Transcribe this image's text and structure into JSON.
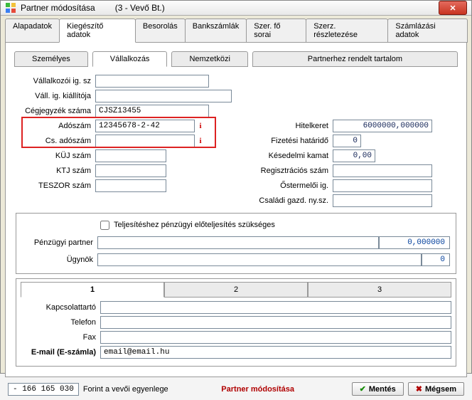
{
  "window": {
    "title": "Partner módosítása",
    "subtitle": "(3  -  Vevő Bt.)"
  },
  "tabs": {
    "alapadatok": "Alapadatok",
    "kiegeszito": "Kiegészítő adatok",
    "besorolas": "Besorolás",
    "bankszamlak": "Bankszámlák",
    "szerfosorai": "Szer. fő sorai",
    "szerreszlet": "Szerz. részletezése",
    "szamlazasi": "Számlázási adatok"
  },
  "subtabs": {
    "szemelyes": "Személyes",
    "vallalkozas": "Vállalkozás",
    "nemzetkozi": "Nemzetközi",
    "partnerhez": "Partnerhez rendelt tartalom"
  },
  "labels": {
    "vallalkozoi": "Vállalkozói ig. sz",
    "vallig": "Váll. ig. kiállítója",
    "cegjegyzek": "Cégjegyzék száma",
    "adoszam": "Adószám",
    "csadoszam": "Cs. adószám",
    "kuj": "KÜJ szám",
    "ktj": "KTJ szám",
    "teszor": "TESZOR szám",
    "hitelkeret": "Hitelkeret",
    "fizhatarido": "Fizetési határidő",
    "kesedelmi": "Késedelmi kamat",
    "regszam": "Regisztrációs szám",
    "ostermelo": "Őstermelői ig.",
    "csaladi": "Családi gazd. ny.sz.",
    "teljesiteshez": "Teljesítéshez pénzügyi előteljesítés szükséges",
    "penzugyipartner": "Pénzügyi partner",
    "ugynok": "Ügynök"
  },
  "values": {
    "vallalkozoi": "",
    "vallig": "",
    "cegjegyzek": "CJSZ13455",
    "adoszam": "12345678-2-42",
    "csadoszam": "",
    "kuj": "",
    "ktj": "",
    "teszor": "",
    "hitelkeret": "6000000,000000",
    "fizhatarido": "0",
    "kesedelmi": "0,00",
    "regszam": "",
    "ostermelo": "",
    "csaladi": "",
    "partner_rate": "0,000000",
    "ugynok_val": "0"
  },
  "contacts": {
    "tab1": "1",
    "tab2": "2",
    "tab3": "3",
    "kapcsolattarto_label": "Kapcsolattartó",
    "telefon_label": "Telefon",
    "fax_label": "Fax",
    "email_label": "E-mail (E-számla)",
    "kapcsolattarto": "",
    "telefon": "",
    "fax": "",
    "email": "email@email.hu"
  },
  "footer": {
    "balance": "- 166 165 030",
    "balance_label": "Forint a vevői egyenlege",
    "status": "Partner módosítása",
    "save": "Mentés",
    "cancel": "Mégsem"
  }
}
